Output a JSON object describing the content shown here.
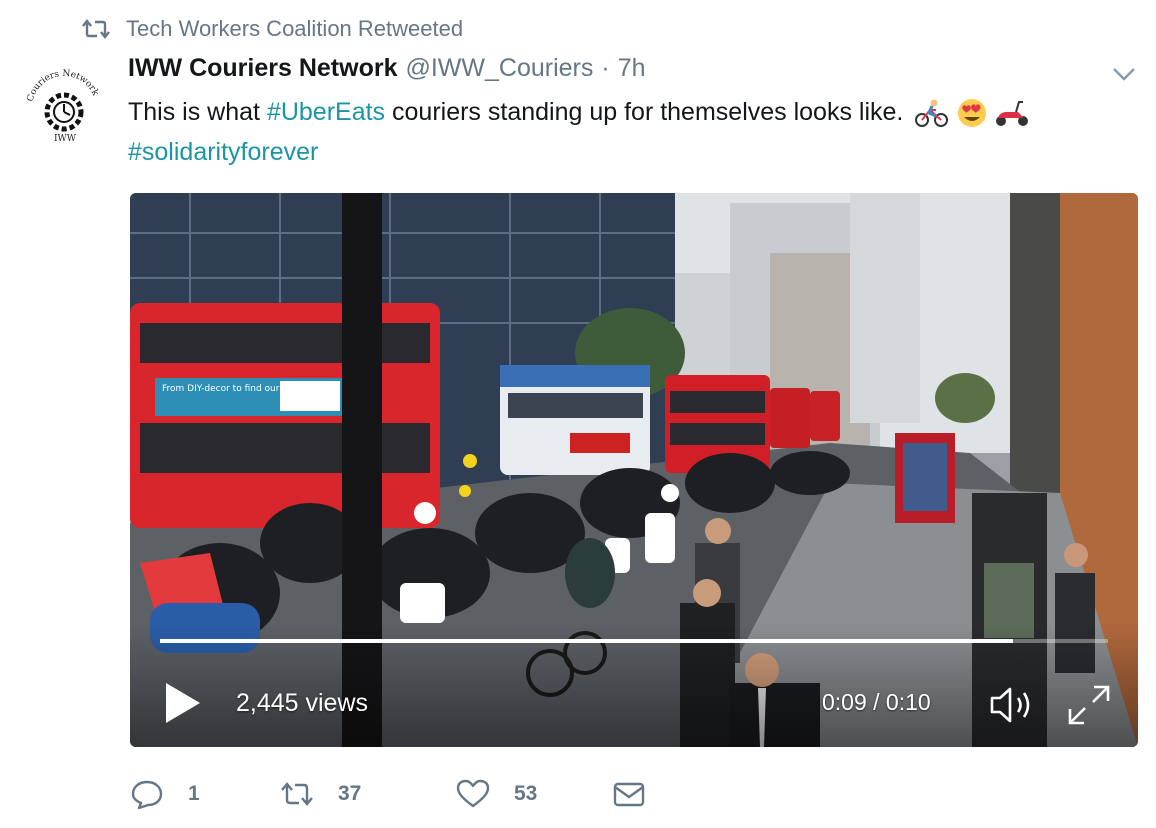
{
  "retweet_banner": {
    "text": "Tech Workers Coalition Retweeted"
  },
  "author": {
    "name": "IWW Couriers Network",
    "handle": "@IWW_Couriers",
    "separator": "·",
    "time": "7h",
    "avatar_text": "Couriers Network",
    "avatar_sub": "IWW"
  },
  "tweet": {
    "text_1": "This is what ",
    "hashtag_1": "#UberEats",
    "text_2": " couriers standing up for themselves looks like.",
    "hashtag_2": "#solidarityforever",
    "emojis": [
      "bicyclist-emoji",
      "heart-eyes-emoji",
      "scooter-emoji"
    ]
  },
  "video": {
    "views": "2,445 views",
    "time": "0:09 / 0:10",
    "progress": 0.9,
    "bus_ad_text": "From DIY-decor to find our new look"
  },
  "actions": {
    "replies": "1",
    "retweets": "37",
    "likes": "53"
  },
  "colors": {
    "hashtag": "#1b95a6",
    "secondary": "#657786",
    "text": "#14171a"
  }
}
